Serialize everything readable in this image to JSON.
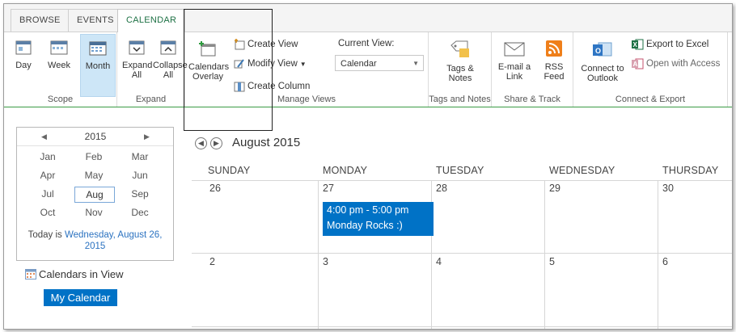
{
  "tabs": [
    {
      "label": "BROWSE",
      "active": false
    },
    {
      "label": "EVENTS",
      "active": false
    },
    {
      "label": "CALENDAR",
      "active": true
    }
  ],
  "ribbon": {
    "scope": {
      "label": "Scope",
      "day": "Day",
      "week": "Week",
      "month": "Month",
      "selected": "Month"
    },
    "expand": {
      "label": "Expand",
      "expand_all": "Expand All",
      "collapse_all": "Collapse All"
    },
    "manage_views": {
      "label": "Manage Views",
      "calendars_overlay": "Calendars Overlay",
      "create_view": "Create View",
      "modify_view": "Modify View",
      "create_column": "Create Column",
      "current_view_label": "Current View:",
      "current_view_value": "Calendar"
    },
    "tags_notes": {
      "label": "Tags and Notes",
      "button": "Tags & Notes"
    },
    "share_track": {
      "label": "Share & Track",
      "email": "E-mail a Link",
      "rss": "RSS Feed"
    },
    "connect_export": {
      "label": "Connect & Export",
      "connect_outlook": "Connect to Outlook",
      "export_excel": "Export to Excel",
      "open_access": "Open with Access"
    }
  },
  "date_picker": {
    "year": "2015",
    "months": [
      "Jan",
      "Feb",
      "Mar",
      "Apr",
      "May",
      "Jun",
      "Jul",
      "Aug",
      "Sep",
      "Oct",
      "Nov",
      "Dec"
    ],
    "current_month": "Aug",
    "today_prefix": "Today is",
    "today_date": "Wednesday, August 26, 2015"
  },
  "calendars_in_view": {
    "title": "Calendars in View",
    "items": [
      "My Calendar"
    ]
  },
  "calendar": {
    "title": "August 2015",
    "day_headers": [
      "SUNDAY",
      "MONDAY",
      "TUESDAY",
      "WEDNESDAY",
      "THURSDAY"
    ],
    "weeks": [
      [
        "26",
        "27",
        "28",
        "29",
        "30"
      ],
      [
        "2",
        "3",
        "4",
        "5",
        "6"
      ]
    ],
    "event": {
      "time": "4:00 pm - 5:00 pm",
      "title": "Monday Rocks :)"
    }
  },
  "colors": {
    "accent_green": "#1e7145",
    "selection_blue": "#0072c6",
    "link_blue": "#2b72c0"
  }
}
